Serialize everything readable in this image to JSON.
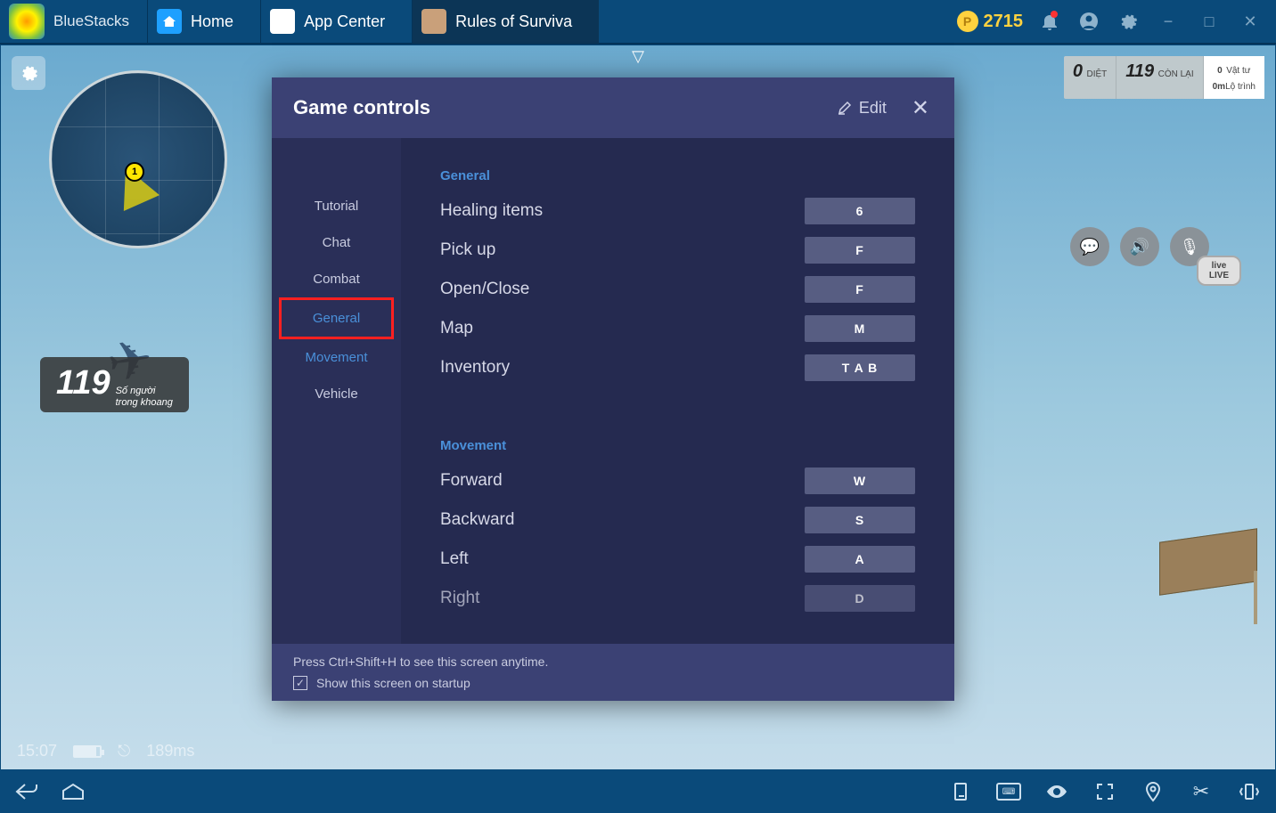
{
  "topbar": {
    "brand": "BlueStacks",
    "tabs": [
      {
        "label": "Home"
      },
      {
        "label": "App Center"
      },
      {
        "label": "Rules of Surviva"
      }
    ],
    "coins": "2715"
  },
  "hud": {
    "kill_label": "DIỆT",
    "kill_value": "0",
    "alive_value": "119",
    "alive_label": "CÒN LẠI",
    "supply_value": "0",
    "supply_label": "Vật tư",
    "dist_value": "0m",
    "dist_label": "Lộ trình"
  },
  "count": {
    "num": "119",
    "label1": "Số người",
    "label2": "trong khoang"
  },
  "mm_player": "1",
  "status": {
    "time": "15:07",
    "ping": "189ms"
  },
  "live": {
    "top": "live",
    "bottom": "LIVE"
  },
  "modal": {
    "title": "Game controls",
    "edit": "Edit",
    "sidebar": [
      {
        "label": "Tutorial",
        "link": false
      },
      {
        "label": "Chat",
        "link": false
      },
      {
        "label": "Combat",
        "link": false
      },
      {
        "label": "General",
        "link": true,
        "selected": true
      },
      {
        "label": "Movement",
        "link": true
      },
      {
        "label": "Vehicle",
        "link": false
      }
    ],
    "sections": [
      {
        "title": "General",
        "rows": [
          {
            "label": "Healing items",
            "key": "6"
          },
          {
            "label": "Pick up",
            "key": "F"
          },
          {
            "label": "Open/Close",
            "key": "F"
          },
          {
            "label": "Map",
            "key": "M"
          },
          {
            "label": "Inventory",
            "key": "T A B"
          }
        ]
      },
      {
        "title": "Movement",
        "rows": [
          {
            "label": "Forward",
            "key": "W"
          },
          {
            "label": "Backward",
            "key": "S"
          },
          {
            "label": "Left",
            "key": "A"
          },
          {
            "label": "Right",
            "key": "D"
          }
        ]
      }
    ],
    "footer_hint": "Press Ctrl+Shift+H to see this screen anytime.",
    "footer_check": "Show this screen on startup"
  }
}
